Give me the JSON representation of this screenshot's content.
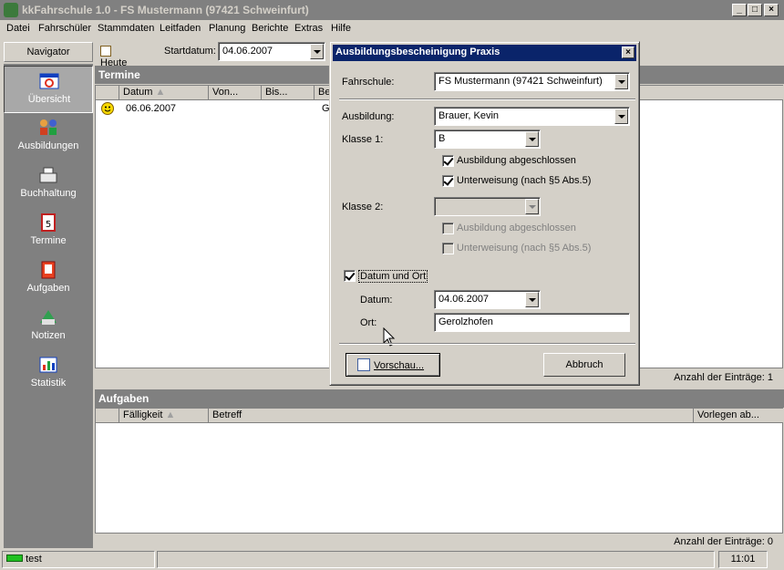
{
  "window": {
    "title": "kkFahrschule 1.0  -  FS Mustermann (97421 Schweinfurt)"
  },
  "menu": [
    "Datei",
    "Fahrschüler",
    "Stammdaten",
    "Leitfaden",
    "Planung",
    "Berichte",
    "Extras",
    "Hilfe"
  ],
  "navigator": {
    "title": "Navigator",
    "items": [
      "Übersicht",
      "Ausbildungen",
      "Buchhaltung",
      "Termine",
      "Aufgaben",
      "Notizen",
      "Statistik"
    ]
  },
  "toolbar": {
    "heute_label": "Heute",
    "startdatum_label": "Startdatum:",
    "startdatum_value": "04.06.2007"
  },
  "termine": {
    "title": "Termine",
    "columns": [
      "Datum",
      "Von...",
      "Bis...",
      "Be"
    ],
    "rows": [
      {
        "datum": "06.06.2007",
        "von": "",
        "bis": "",
        "be": "G"
      }
    ],
    "count_label": "Anzahl der Einträge: 1"
  },
  "aufgaben": {
    "title": "Aufgaben",
    "columns": [
      "Fälligkeit",
      "Betreff",
      "Vorlegen ab..."
    ],
    "count_label": "Anzahl der Einträge: 0"
  },
  "dialog": {
    "title": "Ausbildungsbescheinigung Praxis",
    "fahrschule_label": "Fahrschule:",
    "fahrschule_value": "FS Mustermann (97421 Schweinfurt)",
    "ausbildung_label": "Ausbildung:",
    "ausbildung_value": "Brauer, Kevin",
    "klasse1_label": "Klasse 1:",
    "klasse1_value": "B",
    "k1_abgeschlossen": "Ausbildung abgeschlossen",
    "k1_unterweisung": "Unterweisung (nach §5 Abs.5)",
    "klasse2_label": "Klasse 2:",
    "klasse2_value": "",
    "k2_abgeschlossen": "Ausbildung abgeschlossen",
    "k2_unterweisung": "Unterweisung (nach §5 Abs.5)",
    "datum_ort_label": "Datum und Ort",
    "datum_label": "Datum:",
    "datum_value": "04.06.2007",
    "ort_label": "Ort:",
    "ort_value": "Gerolzhofen",
    "vorschau_label": "Vorschau...",
    "abbruch_label": "Abbruch"
  },
  "statusbar": {
    "user": "test",
    "time": "11:01"
  },
  "colors": {
    "titlebar_inactive": "#808080",
    "dialog_title": "#0a246a",
    "face": "#d4d0c8",
    "nav_bg": "#808080"
  }
}
